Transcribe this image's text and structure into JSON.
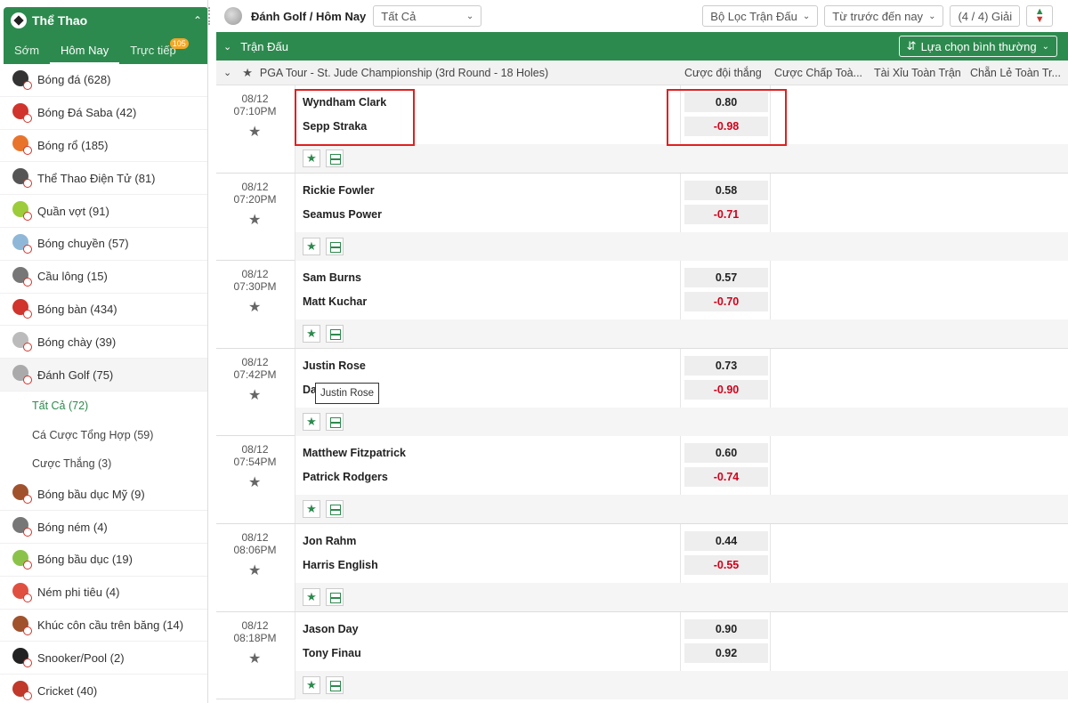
{
  "sidebar": {
    "title": "Thể Thao",
    "tabs": [
      {
        "label": "Sớm"
      },
      {
        "label": "Hôm Nay"
      },
      {
        "label": "Trực tiếp",
        "badge": "105"
      }
    ],
    "items": [
      {
        "label": "Bóng đá (628)",
        "icon": "soccer-ball-icon",
        "color": "#333333"
      },
      {
        "label": "Bóng Đá Saba (42)",
        "icon": "saba-soccer-icon",
        "color": "#d0342c"
      },
      {
        "label": "Bóng rổ (185)",
        "icon": "basketball-icon",
        "color": "#e8742c"
      },
      {
        "label": "Thể Thao Điện Tử (81)",
        "icon": "esports-headset-icon",
        "color": "#555555"
      },
      {
        "label": "Quần vợt (91)",
        "icon": "tennis-ball-icon",
        "color": "#9ccc3a"
      },
      {
        "label": "Bóng chuyền (57)",
        "icon": "volleyball-icon",
        "color": "#8fb8d8"
      },
      {
        "label": "Cầu lông (15)",
        "icon": "badminton-shuttle-icon",
        "color": "#777777"
      },
      {
        "label": "Bóng bàn (434)",
        "icon": "table-tennis-icon",
        "color": "#d0342c"
      },
      {
        "label": "Bóng chày (39)",
        "icon": "baseball-icon",
        "color": "#bbbbbb"
      },
      {
        "label": "Đánh Golf (75)",
        "icon": "golf-ball-icon",
        "color": "#aaaaaa"
      }
    ],
    "golf_sub": [
      {
        "label": "Tất Cả (72)"
      },
      {
        "label": "Cá Cược Tổng Hợp (59)"
      },
      {
        "label": "Cược Thắng (3)"
      }
    ],
    "items2": [
      {
        "label": "Bóng bầu dục Mỹ (9)",
        "icon": "american-football-icon",
        "color": "#a0522d"
      },
      {
        "label": "Bóng ném (4)",
        "icon": "handball-icon",
        "color": "#777777"
      },
      {
        "label": "Bóng bầu dục (19)",
        "icon": "rugby-ball-icon",
        "color": "#8bc34a"
      },
      {
        "label": "Ném phi tiêu (4)",
        "icon": "darts-target-icon",
        "color": "#e05040"
      },
      {
        "label": "Khúc côn cầu trên băng (14)",
        "icon": "ice-hockey-stick-icon",
        "color": "#a0522d"
      },
      {
        "label": "Snooker/Pool (2)",
        "icon": "snooker-ball-icon",
        "color": "#222222"
      },
      {
        "label": "Cricket (40)",
        "icon": "cricket-ball-icon",
        "color": "#c0392b"
      }
    ]
  },
  "topbar": {
    "title": "Đánh Golf / Hôm Nay",
    "select_value": "Tất Cả",
    "filter_label": "Bộ Lọc Trận Đấu",
    "sort_label": "Từ trước đến nay",
    "league_count": "(4 / 4) Giải"
  },
  "main": {
    "match_header": "Trận Đấu",
    "mode_label": "Lựa chọn bình thường",
    "league": "PGA Tour - St. Jude Championship (3rd Round - 18 Holes)",
    "columns": [
      "Cược đội thắng",
      "Cược Chấp Toà...",
      "Tài Xỉu Toàn Trận",
      "Chẵn Lẻ Toàn Tr..."
    ],
    "tooltip": "Justin Rose"
  },
  "matches": [
    {
      "date": "08/12",
      "time": "07:10PM",
      "team1": "Wyndham Clark",
      "team2": "Sepp Straka",
      "odd1": "0.80",
      "odd2": "-0.98"
    },
    {
      "date": "08/12",
      "time": "07:20PM",
      "team1": "Rickie Fowler",
      "team2": "Seamus Power",
      "odd1": "0.58",
      "odd2": "-0.71"
    },
    {
      "date": "08/12",
      "time": "07:30PM",
      "team1": "Sam Burns",
      "team2": "Matt Kuchar",
      "odd1": "0.57",
      "odd2": "-0.70"
    },
    {
      "date": "08/12",
      "time": "07:42PM",
      "team1": "Justin Rose",
      "team2": "Da",
      "odd1": "0.73",
      "odd2": "-0.90"
    },
    {
      "date": "08/12",
      "time": "07:54PM",
      "team1": "Matthew Fitzpatrick",
      "team2": "Patrick Rodgers",
      "odd1": "0.60",
      "odd2": "-0.74"
    },
    {
      "date": "08/12",
      "time": "08:06PM",
      "team1": "Jon Rahm",
      "team2": "Harris English",
      "odd1": "0.44",
      "odd2": "-0.55"
    },
    {
      "date": "08/12",
      "time": "08:18PM",
      "team1": "Jason Day",
      "team2": "Tony Finau",
      "odd1": "0.90",
      "odd2": "0.92"
    }
  ],
  "colors": {
    "brand": "#2d8a4e",
    "negative": "#d0021b",
    "highlight": "#e02020"
  }
}
